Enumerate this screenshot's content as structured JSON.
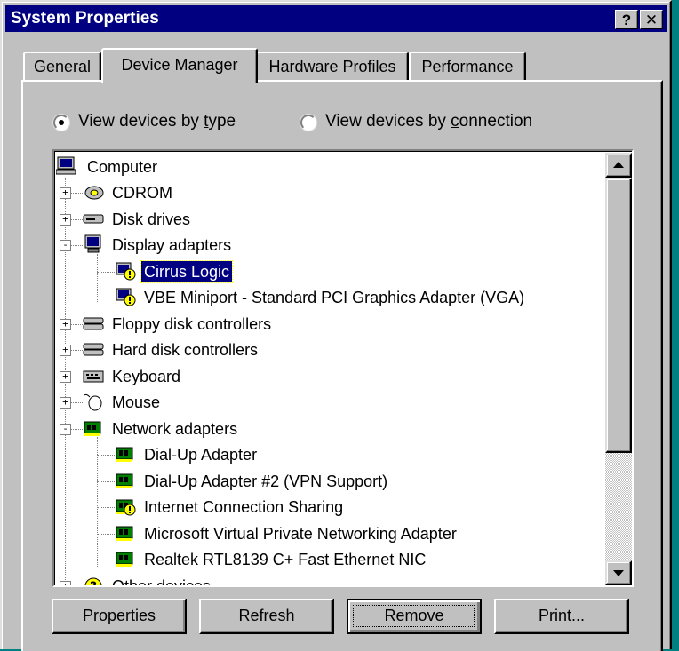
{
  "window": {
    "title": "System Properties",
    "help_label": "?",
    "close_label": "✕"
  },
  "tabs": [
    {
      "label": "General"
    },
    {
      "label": "Device Manager"
    },
    {
      "label": "Hardware Profiles"
    },
    {
      "label": "Performance"
    }
  ],
  "view": {
    "by_type": "View devices by type",
    "by_connection": "View devices by connection",
    "selected": "by_type"
  },
  "tree": {
    "root": "Computer",
    "items": [
      {
        "label": "CDROM",
        "icon": "cdrom-icon"
      },
      {
        "label": "Disk drives",
        "icon": "disk-drive-icon"
      },
      {
        "label": "Display adapters",
        "icon": "monitor-icon"
      },
      {
        "label": "Cirrus Logic",
        "icon": "display-adapter-warning-icon",
        "selected": true
      },
      {
        "label": "VBE Miniport - Standard PCI Graphics Adapter (VGA)",
        "icon": "display-adapter-warning-icon"
      },
      {
        "label": "Floppy disk controllers",
        "icon": "controller-icon"
      },
      {
        "label": "Hard disk controllers",
        "icon": "controller-icon"
      },
      {
        "label": "Keyboard",
        "icon": "keyboard-icon"
      },
      {
        "label": "Mouse",
        "icon": "mouse-icon"
      },
      {
        "label": "Network adapters",
        "icon": "network-card-icon"
      },
      {
        "label": "Dial-Up Adapter",
        "icon": "network-card-icon"
      },
      {
        "label": "Dial-Up Adapter #2 (VPN Support)",
        "icon": "network-card-icon"
      },
      {
        "label": "Internet Connection Sharing",
        "icon": "network-card-warning-icon"
      },
      {
        "label": "Microsoft Virtual Private Networking Adapter",
        "icon": "network-card-icon"
      },
      {
        "label": "Realtek RTL8139 C+ Fast Ethernet NIC",
        "icon": "network-card-icon"
      },
      {
        "label": "Other devices",
        "icon": "question-icon"
      }
    ]
  },
  "buttons": {
    "properties": "Properties",
    "refresh": "Refresh",
    "remove": "Remove",
    "print": "Print..."
  },
  "colors": {
    "titlebar": "#000080",
    "face": "#c0c0c0",
    "selection": "#000080",
    "warning": "#ffff00"
  }
}
